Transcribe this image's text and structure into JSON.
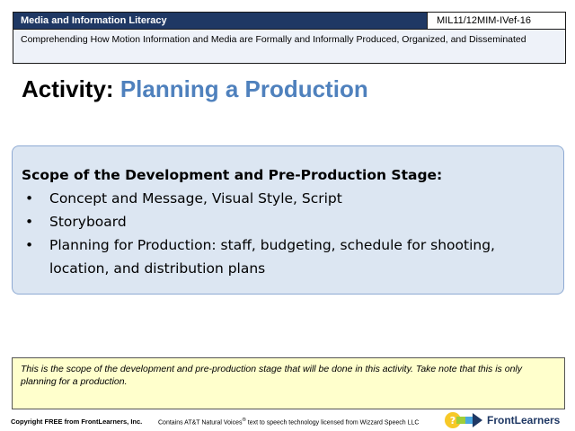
{
  "header": {
    "course_title": "Media and Information Literacy",
    "course_code": "MIL11/12MIM-IVef-16",
    "subtitle": "Comprehending How Motion Information and Media are Formally and Informally Produced, Organized, and Disseminated"
  },
  "slide": {
    "activity_prefix": "Activity:",
    "activity_topic": "Planning a Production",
    "content": {
      "heading": "Scope of the Development and Pre-Production  Stage:",
      "bullet_glyph": "•",
      "items": [
        "Concept and Message, Visual Style, Script",
        "Storyboard",
        "Planning for Production: staff, budgeting, schedule for shooting, location, and distribution plans"
      ]
    },
    "note": "This is the scope of the development and pre-production stage that will be done in this activity. Take note that this is only planning for a production."
  },
  "footer": {
    "copyright": "Copyright FREE from FrontLearners, Inc.",
    "notice_before": "Contains AT&T Natural Voices",
    "notice_reg": "®",
    "notice_after": " text to speech technology licensed from Wizzard Speech LLC",
    "logo_text": "FrontLearners",
    "logo_colors": [
      "#f7c928",
      "#9fce3a",
      "#4aa8e0",
      "#1f3864"
    ]
  }
}
